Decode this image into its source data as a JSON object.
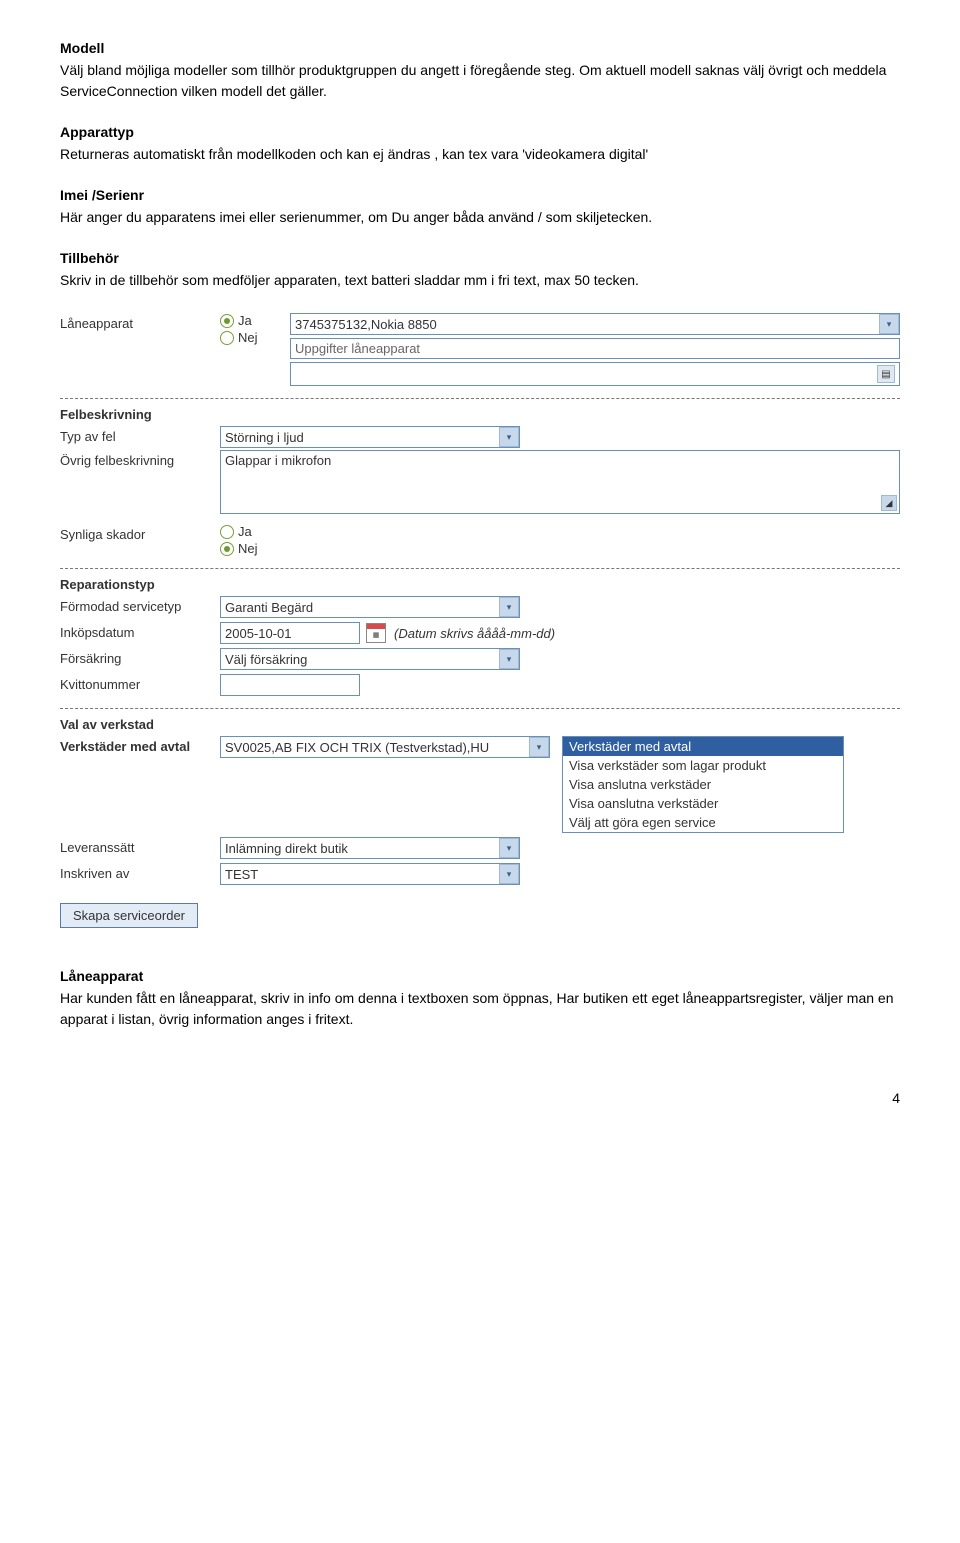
{
  "doc": {
    "s_modell": {
      "title": "Modell",
      "body": "Välj bland möjliga modeller som tillhör produktgruppen du angett i föregående steg. Om aktuell modell saknas välj övrigt och meddela ServiceConnection vilken modell det gäller."
    },
    "s_apparattyp": {
      "title": "Apparattyp",
      "body": "Returneras automatiskt från modellkoden och kan ej ändras , kan tex vara 'videokamera digital'"
    },
    "s_imei": {
      "title": "Imei /Serienr",
      "body": "Här anger du apparatens imei eller serienummer, om Du anger båda använd / som skiljetecken."
    },
    "s_tillbehor": {
      "title": "Tillbehör",
      "body": "Skriv in de tillbehör som medföljer apparaten, text batteri sladdar mm i fri text, max 50 tecken."
    },
    "s_laneapparat": {
      "title": "Låneapparat",
      "body": "Har kunden fått en låneapparat, skriv in info om denna i textboxen som öppnas, Har butiken ett eget låneappartsregister, väljer man en apparat i listan, övrig information anges i fritext."
    }
  },
  "form": {
    "loan": {
      "label": "Låneapparat",
      "yes": "Ja",
      "no": "Nej",
      "select_value": "3745375132,Nokia 8850",
      "desc_placeholder": "Uppgifter låneapparat",
      "input_value": ""
    },
    "felbeskrivning": {
      "group": "Felbeskrivning",
      "typ_label": "Typ av fel",
      "typ_value": "Störning i ljud",
      "ovrig_label": "Övrig felbeskrivning",
      "ovrig_value": "Glappar i mikrofon",
      "synliga_label": "Synliga skador",
      "yes": "Ja",
      "no": "Nej"
    },
    "rep": {
      "group": "Reparationstyp",
      "formodad_label": "Förmodad servicetyp",
      "formodad_value": "Garanti Begärd",
      "inkop_label": "Inköpsdatum",
      "inkop_value": "2005-10-01",
      "inkop_note": "(Datum skrivs åååå-mm-dd)",
      "forsak_label": "Försäkring",
      "forsak_value": "Välj försäkring",
      "kvitto_label": "Kvittonummer",
      "kvitto_value": ""
    },
    "workshop": {
      "group": "Val av verkstad",
      "avtal_label": "Verkstäder med avtal",
      "avtal_value": "SV0025,AB FIX OCH TRIX (Testverkstad),HU",
      "options": [
        "Verkstäder med avtal",
        "Visa verkstäder som lagar produkt",
        "Visa anslutna verkstäder",
        "Visa oanslutna verkstäder",
        "Välj att göra egen service"
      ],
      "leverans_label": "Leveranssätt",
      "leverans_value": "Inlämning direkt butik",
      "inskriven_label": "Inskriven av",
      "inskriven_value": "TEST"
    },
    "submit": "Skapa serviceorder"
  },
  "page_num": "4"
}
